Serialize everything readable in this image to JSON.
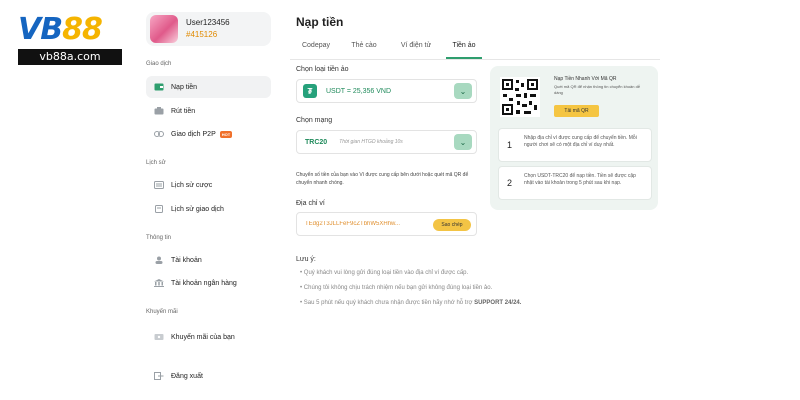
{
  "logo": {
    "brand_left": "VB",
    "brand_num": "88",
    "url": "vb88a.com"
  },
  "user": {
    "name": "User123456",
    "id": "#415126"
  },
  "sidebar": {
    "sections": [
      {
        "title": "Giao dịch",
        "items": [
          {
            "label": "Nạp tiền",
            "icon": "wallet-icon",
            "active": true
          },
          {
            "label": "Rút tiền",
            "icon": "withdraw-icon"
          },
          {
            "label": "Giao dịch P2P",
            "icon": "p2p-icon",
            "badge": "HOT"
          }
        ]
      },
      {
        "title": "Lịch sử",
        "items": [
          {
            "label": "Lịch sử cược",
            "icon": "bet-history-icon"
          },
          {
            "label": "Lịch sử giao dịch",
            "icon": "transaction-history-icon"
          }
        ]
      },
      {
        "title": "Thông tin",
        "items": [
          {
            "label": "Tài khoản",
            "icon": "user-icon"
          },
          {
            "label": "Tài khoản ngân hàng",
            "icon": "bank-icon"
          }
        ]
      },
      {
        "title": "Khuyến mãi",
        "items": [
          {
            "label": "Khuyến mãi của bạn",
            "icon": "ticket-icon"
          }
        ]
      }
    ],
    "logout": {
      "label": "Đăng xuất",
      "icon": "logout-icon"
    }
  },
  "main": {
    "title": "Nạp tiền",
    "tabs": [
      "Codepay",
      "Thẻ cào",
      "Ví điện tử",
      "Tiền ảo"
    ],
    "active_tab": 3,
    "currency": {
      "label": "Chọn loại tiền ảo",
      "value": "USDT = 25,356 VND"
    },
    "network": {
      "label": "Chọn mạng",
      "name": "TRC20",
      "time": "Thời gian HTGD khoảng 10s"
    },
    "note": "Chuyển số tiền của bạn vào Ví được cung cấp bên dưới hoặc quét mã QR để chuyển nhanh chóng.",
    "address": {
      "label": "Địa chỉ ví",
      "value": "TEdg2T3JLLFeF9cZTbhW5XHhw...",
      "copy_label": "Sao chép"
    },
    "notes": {
      "title": "Lưu ý:",
      "items": [
        "Quý khách vui lòng gửi đúng loại tiền vào địa chỉ ví được cấp.",
        "Chúng tôi không chịu trách nhiệm nếu bạn gửi không đúng loại tiền ảo.",
        "Sau 5 phút nếu quý khách chưa nhận được tiền hãy nhớ hỗ trợ"
      ],
      "support": "SUPPORT 24/24."
    }
  },
  "qr_panel": {
    "title": "Nạp Tiền Nhanh Với Mã QR",
    "subtitle": "Quét mã QR để nhận thông tin chuyển khoản dễ dàng",
    "button": "Tải mã QR",
    "steps": [
      {
        "num": "1",
        "text": "Nhập địa chỉ ví được cung cấp để chuyển tiền. Mỗi người chơi sẽ có một địa chỉ ví duy nhất."
      },
      {
        "num": "2",
        "text": "Chọn USDT-TRC20 để nạp tiền. Tiền sẽ được cập nhật vào tài khoản trong 5 phút sau khi nạp."
      }
    ]
  },
  "colors": {
    "accent": "#2f9e6e",
    "highlight": "#f3c445",
    "brand_blue": "#1565c0",
    "brand_yellow": "#f5b400"
  }
}
